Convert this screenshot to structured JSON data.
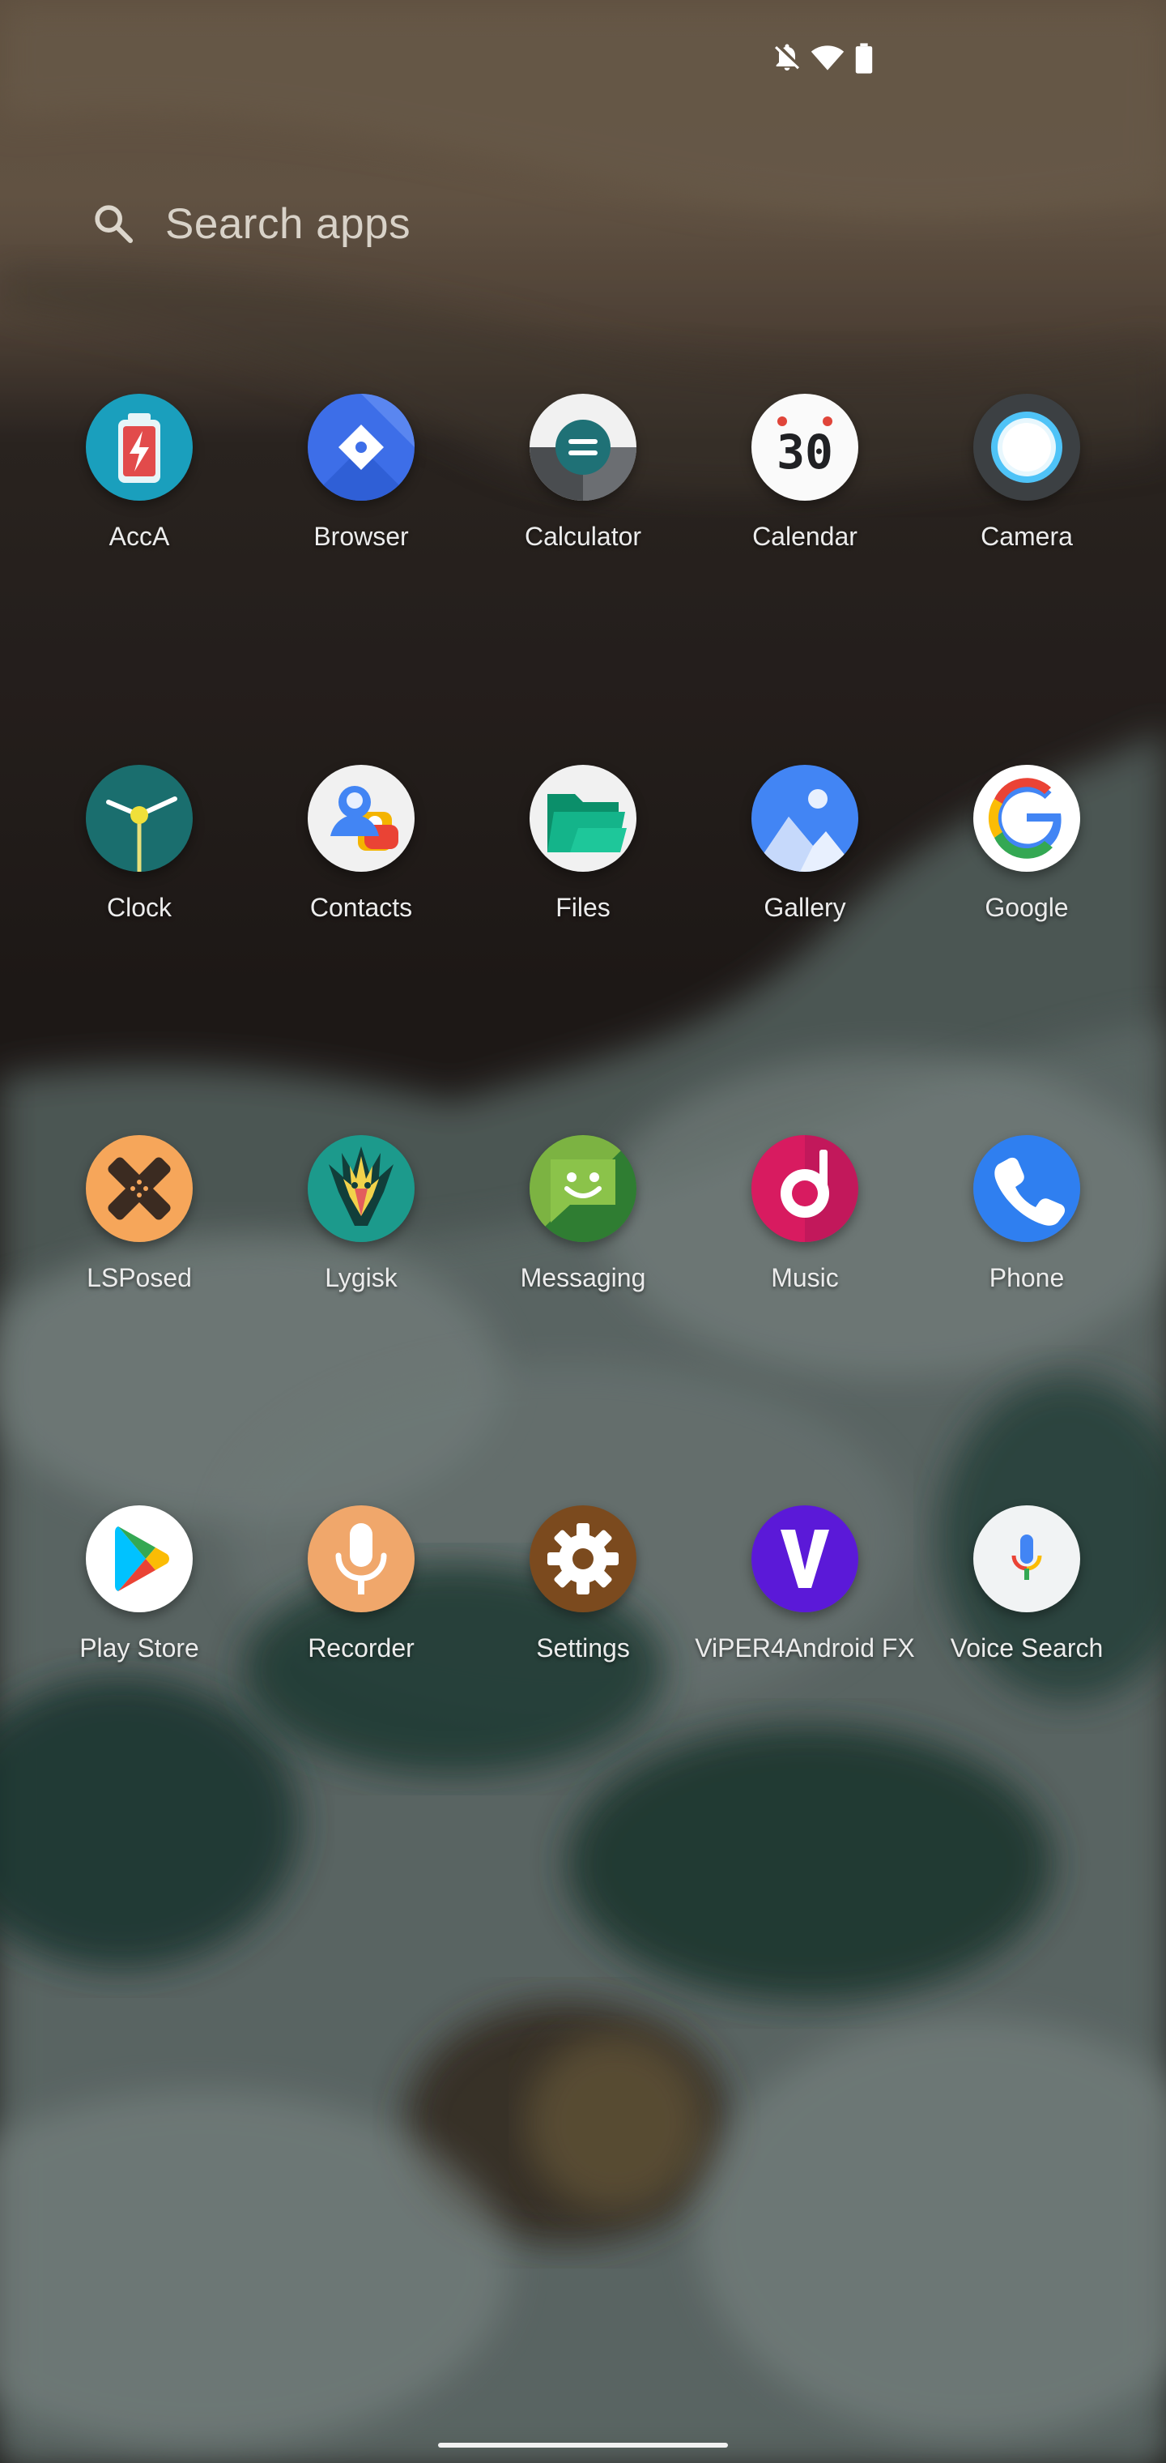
{
  "status_bar": {
    "icons": [
      "notifications-off-icon",
      "wifi-icon",
      "battery-icon"
    ]
  },
  "search": {
    "placeholder": "Search apps",
    "icon": "search-icon"
  },
  "apps": [
    {
      "label": "AccA",
      "icon": "acca-icon"
    },
    {
      "label": "Browser",
      "icon": "browser-icon"
    },
    {
      "label": "Calculator",
      "icon": "calculator-icon"
    },
    {
      "label": "Calendar",
      "icon": "calendar-icon",
      "icon_text": "30"
    },
    {
      "label": "Camera",
      "icon": "camera-icon"
    },
    {
      "label": "Clock",
      "icon": "clock-icon"
    },
    {
      "label": "Contacts",
      "icon": "contacts-icon"
    },
    {
      "label": "Files",
      "icon": "files-icon"
    },
    {
      "label": "Gallery",
      "icon": "gallery-icon"
    },
    {
      "label": "Google",
      "icon": "google-icon"
    },
    {
      "label": "LSPosed",
      "icon": "lsposed-icon"
    },
    {
      "label": "Lygisk",
      "icon": "lygisk-icon"
    },
    {
      "label": "Messaging",
      "icon": "messaging-icon"
    },
    {
      "label": "Music",
      "icon": "music-icon"
    },
    {
      "label": "Phone",
      "icon": "phone-icon"
    },
    {
      "label": "Play Store",
      "icon": "play-store-icon"
    },
    {
      "label": "Recorder",
      "icon": "recorder-icon"
    },
    {
      "label": "Settings",
      "icon": "settings-icon"
    },
    {
      "label": "ViPER4Android FX",
      "icon": "viper4android-icon"
    },
    {
      "label": "Voice Search",
      "icon": "voice-search-icon"
    }
  ]
}
